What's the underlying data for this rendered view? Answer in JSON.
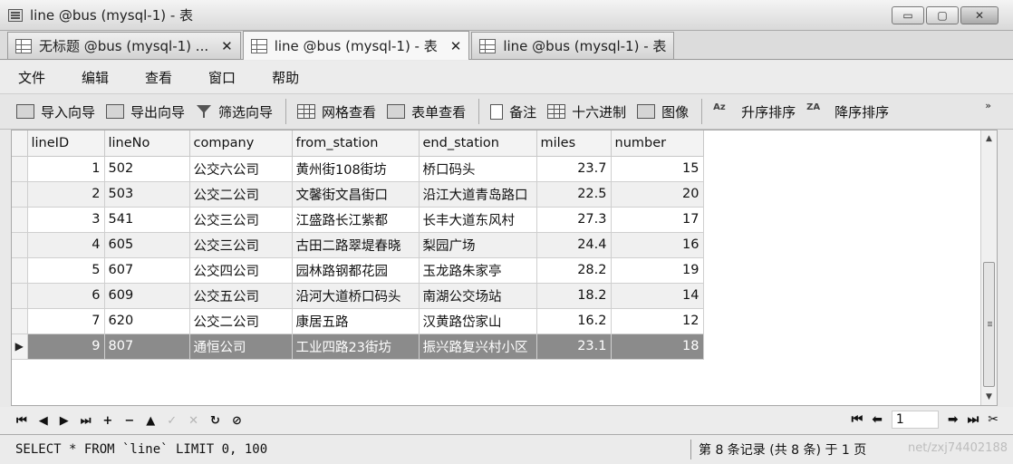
{
  "window": {
    "title": "line @bus (mysql-1) - 表",
    "minimize": "▭",
    "maximize": "▢",
    "close": "✕"
  },
  "tabs": [
    {
      "label": "无标题 @bus (mysql-1) ...",
      "close": "✕"
    },
    {
      "label": "line @bus (mysql-1) - 表",
      "close": "✕"
    },
    {
      "label": "line @bus (mysql-1) - 表",
      "close": ""
    }
  ],
  "menu": [
    "文件",
    "编辑",
    "查看",
    "窗口",
    "帮助"
  ],
  "toolbar": {
    "import_wizard": "导入向导",
    "export_wizard": "导出向导",
    "filter_wizard": "筛选向导",
    "grid_view": "网格查看",
    "form_view": "表单查看",
    "memo": "备注",
    "hex": "十六进制",
    "image": "图像",
    "sort_asc": "升序排序",
    "sort_desc": "降序排序",
    "sort_asc_icon": "Az",
    "sort_desc_icon": "ZA",
    "more": "»"
  },
  "table": {
    "columns": [
      "lineID",
      "lineNo",
      "company",
      "from_station",
      "end_station",
      "miles",
      "number"
    ],
    "rows": [
      [
        "1",
        "502",
        "公交六公司",
        "黄州街108街坊",
        "桥口码头",
        "23.7",
        "15"
      ],
      [
        "2",
        "503",
        "公交二公司",
        "文馨街文昌街口",
        "沿江大道青岛路口",
        "22.5",
        "20"
      ],
      [
        "3",
        "541",
        "公交三公司",
        "江盛路长江紫都",
        "长丰大道东风村",
        "27.3",
        "17"
      ],
      [
        "4",
        "605",
        "公交三公司",
        "古田二路翠堤春晓",
        "梨园广场",
        "24.4",
        "16"
      ],
      [
        "5",
        "607",
        "公交四公司",
        "园林路钢都花园",
        "玉龙路朱家亭",
        "28.2",
        "19"
      ],
      [
        "6",
        "609",
        "公交五公司",
        "沿河大道桥口码头",
        "南湖公交场站",
        "18.2",
        "14"
      ],
      [
        "7",
        "620",
        "公交二公司",
        "康居五路",
        "汉黄路岱家山",
        "16.2",
        "12"
      ],
      [
        "9",
        "807",
        "通恒公司",
        "工业四路23街坊",
        "振兴路复兴村小区",
        "23.1",
        "18"
      ]
    ],
    "selected_indicator": "▶"
  },
  "navigation": {
    "first": "⏮",
    "prev": "◀",
    "next": "▶",
    "last": "⏭",
    "add": "+",
    "delete": "−",
    "up": "▲",
    "check": "✓",
    "cancel": "✕",
    "refresh": "↻",
    "stop": "⊘",
    "page_first": "⏮",
    "page_prev": "⬅",
    "page_number": "1",
    "page_next": "➡",
    "page_last": "⏭",
    "settings": "✂"
  },
  "status": {
    "sql": "SELECT * FROM `line` LIMIT 0, 100",
    "records": "第 8 条记录 (共 8 条) 于 1 页",
    "watermark": "net/zxj74402188"
  }
}
